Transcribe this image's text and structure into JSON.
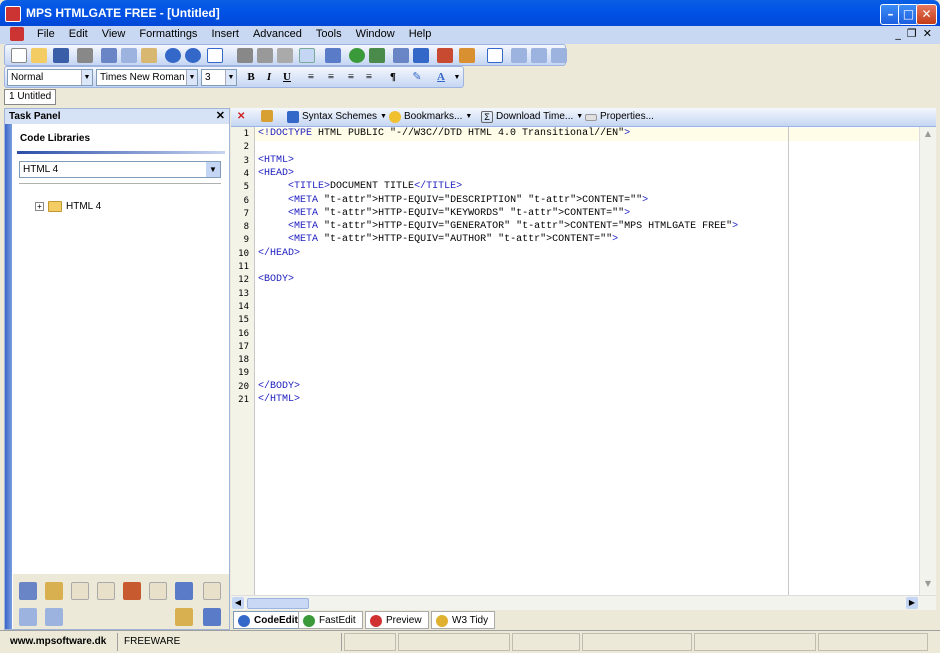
{
  "window": {
    "title": "MPS HTMLGATE FREE - [Untitled]",
    "minimize": "–",
    "maximize": "□",
    "close": "✕"
  },
  "menu": {
    "items": [
      "File",
      "Edit",
      "View",
      "Formattings",
      "Insert",
      "Advanced",
      "Tools",
      "Window",
      "Help"
    ],
    "mdi_minimize": "_",
    "mdi_restore": "❐",
    "mdi_close": "✕"
  },
  "format_toolbar": {
    "style": "Normal",
    "font": "Times New Roman",
    "size": "3",
    "bold": "B",
    "italic": "I",
    "underline": "U",
    "paragraph": "¶",
    "font_color": "A"
  },
  "doc_tabs": [
    "1 Untitled"
  ],
  "task_panel": {
    "title": "Task Panel",
    "close": "✕",
    "library_title": "Code Libraries",
    "library_select": "HTML 4",
    "tree": [
      {
        "label": "HTML 4",
        "expander": "+"
      }
    ]
  },
  "editor_toolbar": {
    "syntax_schemes": "Syntax Schemes",
    "bookmarks": "Bookmarks...",
    "download_time": "Download Time...",
    "properties": "Properties..."
  },
  "editor": {
    "lines": [
      "<!DOCTYPE HTML PUBLIC \"-//W3C//DTD HTML 4.0 Transitional//EN\">",
      "",
      "<HTML>",
      "<HEAD>",
      "     <TITLE>DOCUMENT TITLE</TITLE>",
      "     <META HTTP-EQUIV=\"DESCRIPTION\" CONTENT=\"\">",
      "     <META HTTP-EQUIV=\"KEYWORDS\" CONTENT=\"\">",
      "     <META HTTP-EQUIV=\"GENERATOR\" CONTENT=\"MPS HTMLGATE FREE\">",
      "     <META HTTP-EQUIV=\"AUTHOR\" CONTENT=\"\">",
      "</HEAD>",
      "",
      "<BODY>",
      "",
      "",
      "",
      "",
      "",
      "",
      "",
      "</BODY>",
      "</HTML>"
    ]
  },
  "view_tabs": [
    "CodeEdit",
    "FastEdit",
    "Preview",
    "W3 Tidy"
  ],
  "status": {
    "website": "www.mpsoftware.dk",
    "license": "FREEWARE"
  },
  "colors": {
    "title_bar": "#0153e6",
    "tag": "#2020c0",
    "accent": "#3b67c8"
  }
}
